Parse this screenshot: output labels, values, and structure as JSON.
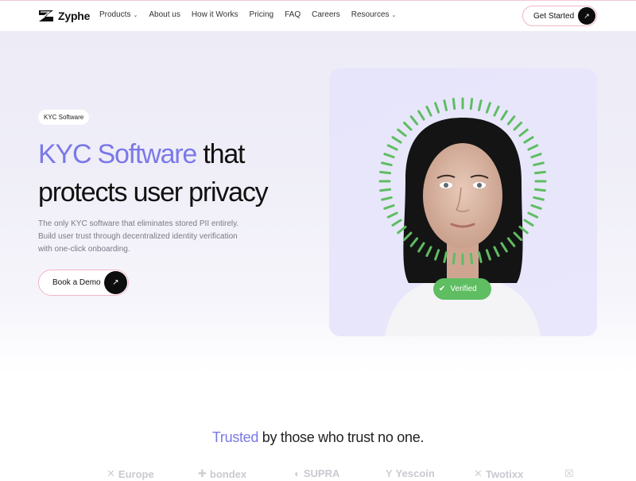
{
  "nav": {
    "brand": "Zyphe",
    "items": [
      {
        "label": "Products",
        "dropdown": true
      },
      {
        "label": "About us",
        "dropdown": false
      },
      {
        "label": "How it Works",
        "dropdown": false
      },
      {
        "label": "Pricing",
        "dropdown": false
      },
      {
        "label": "FAQ",
        "dropdown": false
      },
      {
        "label": "Careers",
        "dropdown": false
      },
      {
        "label": "Resources",
        "dropdown": true
      }
    ],
    "cta": "Get Started"
  },
  "hero": {
    "badge": "KYC Software",
    "headline_accent": "KYC Software",
    "headline_rest_1": " that",
    "headline_line2": "protects user privacy",
    "sub_1": "The only KYC software that eliminates stored PII entirely.",
    "sub_2": "Build user trust through decentralized identity verification",
    "sub_3": "with one-click onboarding.",
    "cta": "Book a Demo",
    "verified_label": "Verified"
  },
  "trusted": {
    "accent": "Trusted",
    "rest": " by those who trust no one."
  },
  "brands": [
    {
      "name": "",
      "glyph": "",
      "partial": true
    },
    {
      "name": "Europe",
      "glyph": "✕"
    },
    {
      "name": "bondex",
      "glyph": "✚"
    },
    {
      "name": "SUPRA",
      "glyph": "◐"
    },
    {
      "name": "Yescoin",
      "glyph": "Y"
    },
    {
      "name": "Twotixx",
      "glyph": "✕"
    },
    {
      "name": "",
      "glyph": "☒"
    }
  ],
  "colors": {
    "accent": "#7b78e8",
    "verified": "#5fbd62",
    "dark": "#0d0d0d",
    "border_pink": "#f2b6c8"
  },
  "icons": {
    "logo": "zyphe-logo-icon",
    "arrow": "arrow-up-right-icon",
    "check": "check-icon",
    "caret": "chevron-down-icon"
  }
}
